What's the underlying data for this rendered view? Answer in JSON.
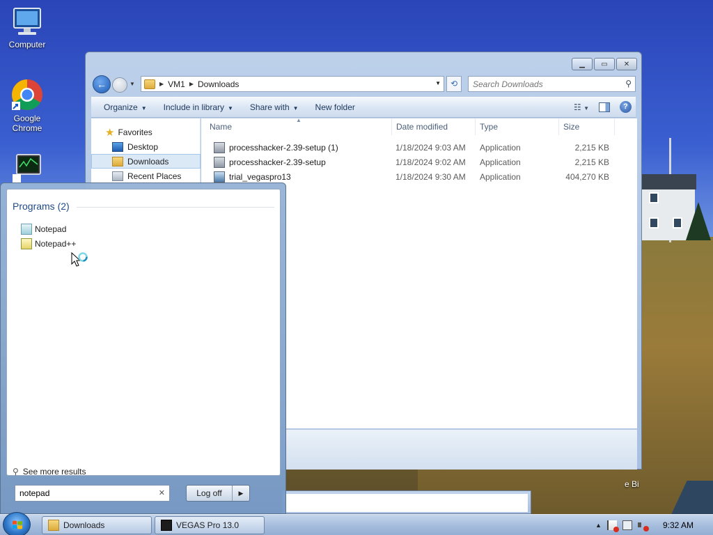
{
  "desktop": {
    "icons": [
      {
        "label": "Computer"
      },
      {
        "label": "Google\nChrome"
      }
    ],
    "partial_label": "e Bi"
  },
  "explorer": {
    "address": {
      "root": "VM1",
      "folder": "Downloads"
    },
    "search_placeholder": "Search Downloads",
    "toolbar": {
      "organize": "Organize",
      "include_in_library": "Include in library",
      "share_with": "Share with",
      "new_folder": "New folder"
    },
    "nav": {
      "favorites": "Favorites",
      "desktop": "Desktop",
      "downloads": "Downloads",
      "recent_places": "Recent Places"
    },
    "columns": {
      "name": "Name",
      "date": "Date modified",
      "type": "Type",
      "size": "Size"
    },
    "files": [
      {
        "name": "processhacker-2.39-setup (1)",
        "date": "1/18/2024 9:03 AM",
        "type": "Application",
        "size": "2,215 KB"
      },
      {
        "name": "processhacker-2.39-setup",
        "date": "1/18/2024 9:02 AM",
        "type": "Application",
        "size": "2,215 KB"
      },
      {
        "name": "trial_vegaspro13",
        "date": "1/18/2024 9:30 AM",
        "type": "Application",
        "size": "404,270 KB"
      }
    ]
  },
  "start_menu": {
    "programs_heading": "Programs (2)",
    "programs": [
      {
        "label": "Notepad"
      },
      {
        "label": "Notepad++"
      }
    ],
    "see_more": "See more results",
    "search_value": "notepad",
    "log_off": "Log off"
  },
  "taskbar": {
    "tasks": [
      {
        "label": "Downloads"
      },
      {
        "label": "VEGAS Pro 13.0"
      }
    ],
    "clock": "9:32 AM"
  }
}
